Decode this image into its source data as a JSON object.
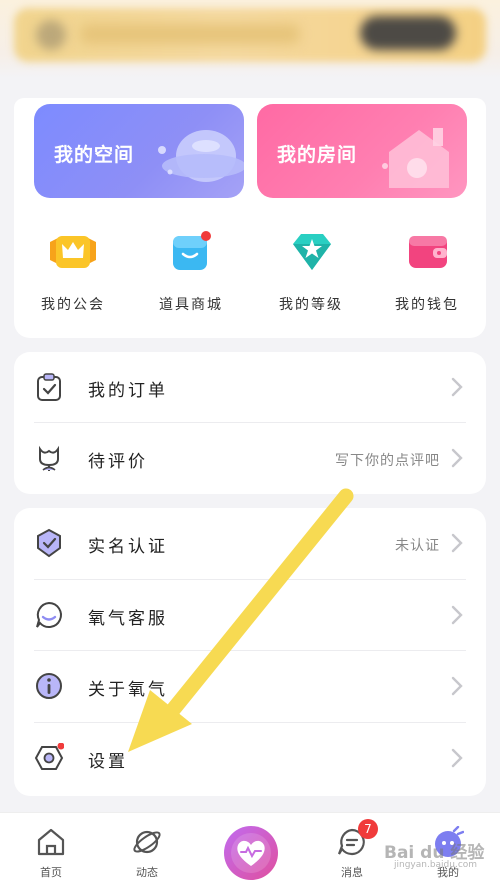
{
  "space_tiles": [
    {
      "label": "我的空间"
    },
    {
      "label": "我的房间"
    }
  ],
  "grid": [
    {
      "label": "我的公会",
      "icon": "crown-badge-icon",
      "color": "#f5b925"
    },
    {
      "label": "道具商城",
      "icon": "shopping-bag-icon",
      "color": "#3bb8f2"
    },
    {
      "label": "我的等级",
      "icon": "diamond-star-icon",
      "color": "#29cfc2"
    },
    {
      "label": "我的钱包",
      "icon": "wallet-icon",
      "color": "#f2447f"
    }
  ],
  "orders": [
    {
      "label": "我的订单",
      "icon": "clipboard-check-icon",
      "right": ""
    },
    {
      "label": "待评价",
      "icon": "flower-icon",
      "right": "写下你的点评吧"
    }
  ],
  "settings_list": [
    {
      "label": "实名认证",
      "icon": "verified-shield-icon",
      "right": "未认证"
    },
    {
      "label": "氧气客服",
      "icon": "chat-bubble-icon",
      "right": ""
    },
    {
      "label": "关于氧气",
      "icon": "info-icon",
      "right": ""
    },
    {
      "label": "设置",
      "icon": "settings-hexagon-icon",
      "right": ""
    }
  ],
  "tabbar": {
    "home": "首页",
    "moments": "动态",
    "messages": "消息",
    "mine": "我的",
    "message_badge": "7"
  },
  "watermark": {
    "brand": "Bai du 经验",
    "url": "jingyan.baidu.com"
  },
  "colors": {
    "accent": "#7d7ef0",
    "pink": "#ff6aa4",
    "arrow": "#f7da52",
    "badge": "#f03b3b"
  }
}
